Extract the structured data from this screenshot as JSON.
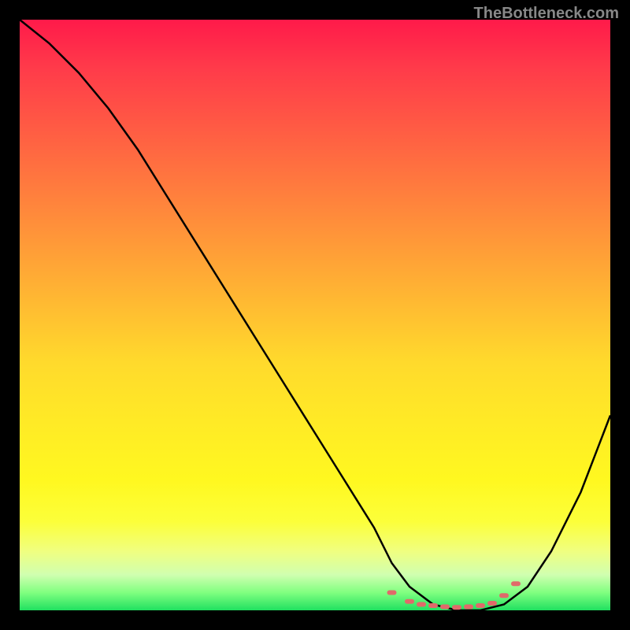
{
  "watermark": "TheBottleneck.com",
  "chart_data": {
    "type": "line",
    "title": "",
    "xlabel": "",
    "ylabel": "",
    "xlim": [
      0,
      100
    ],
    "ylim": [
      0,
      100
    ],
    "series": [
      {
        "name": "bottleneck-curve",
        "x": [
          0,
          5,
          10,
          15,
          20,
          25,
          30,
          35,
          40,
          45,
          50,
          55,
          60,
          63,
          66,
          70,
          74,
          78,
          82,
          86,
          90,
          95,
          100
        ],
        "values": [
          100,
          96,
          91,
          85,
          78,
          70,
          62,
          54,
          46,
          38,
          30,
          22,
          14,
          8,
          4,
          1,
          0,
          0,
          1,
          4,
          10,
          20,
          33
        ]
      }
    ],
    "markers": {
      "name": "optimal-range-dots",
      "color": "#e06a6a",
      "x": [
        63,
        66,
        68,
        70,
        72,
        74,
        76,
        78,
        80,
        82,
        84
      ],
      "values": [
        3,
        1.5,
        1,
        0.8,
        0.6,
        0.5,
        0.6,
        0.8,
        1.2,
        2.5,
        4.5
      ]
    },
    "gradient_stops": [
      {
        "pct": 0,
        "color": "#ff1a4a"
      },
      {
        "pct": 50,
        "color": "#ffda2c"
      },
      {
        "pct": 85,
        "color": "#fcff3a"
      },
      {
        "pct": 100,
        "color": "#20e060"
      }
    ]
  }
}
